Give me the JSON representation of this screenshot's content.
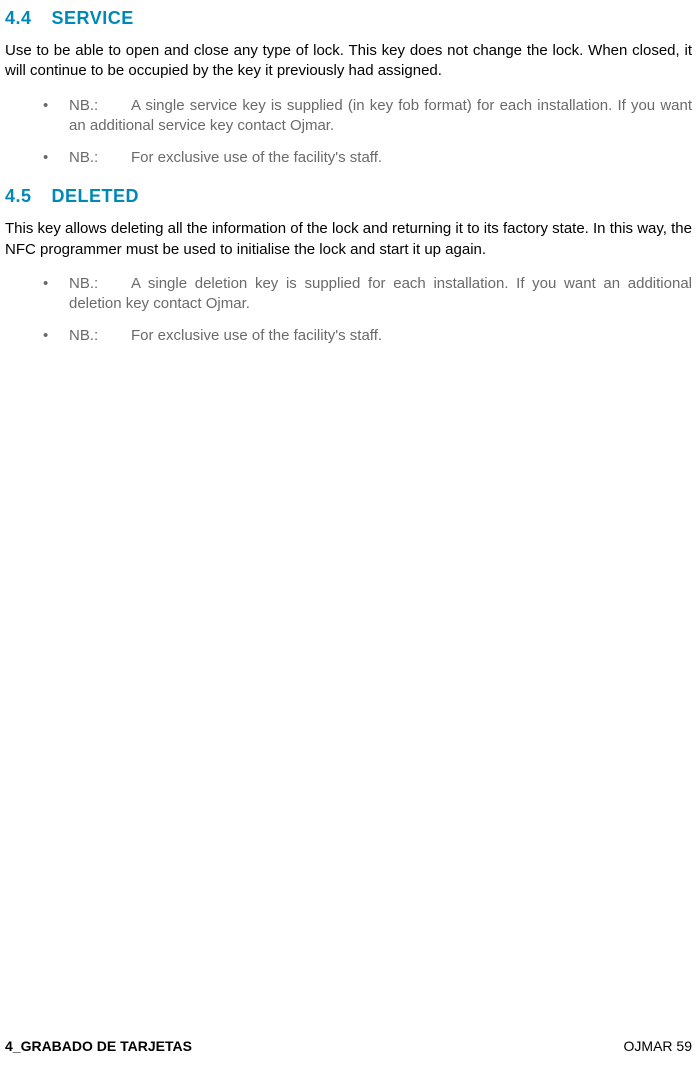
{
  "sections": [
    {
      "number": "4.4",
      "title": "SERVICE",
      "body": "Use to be able to open and close any type of lock. This key does not change the lock. When closed, it will continue to be occupied by the key it previously had assigned.",
      "bullets": [
        {
          "label": "NB.:",
          "text": "A single service key is supplied (in key fob format) for each installation. If you want an additional service key contact Ojmar."
        },
        {
          "label": "NB.:",
          "text": "For exclusive use of the facility's staff."
        }
      ]
    },
    {
      "number": "4.5",
      "title": "DELETED",
      "body": "This key allows deleting all the information of the lock and returning it to its factory state. In this way, the NFC programmer must be used to initialise the lock and start it up again.",
      "bullets": [
        {
          "label": "NB.:",
          "text": "A single deletion key is supplied for each installation. If you want an additional deletion key contact Ojmar."
        },
        {
          "label": "NB.:",
          "text": "For exclusive use of the facility's staff."
        }
      ]
    }
  ],
  "footer": {
    "left": "4_GRABADO DE TARJETAS",
    "right": "OJMAR 59"
  }
}
